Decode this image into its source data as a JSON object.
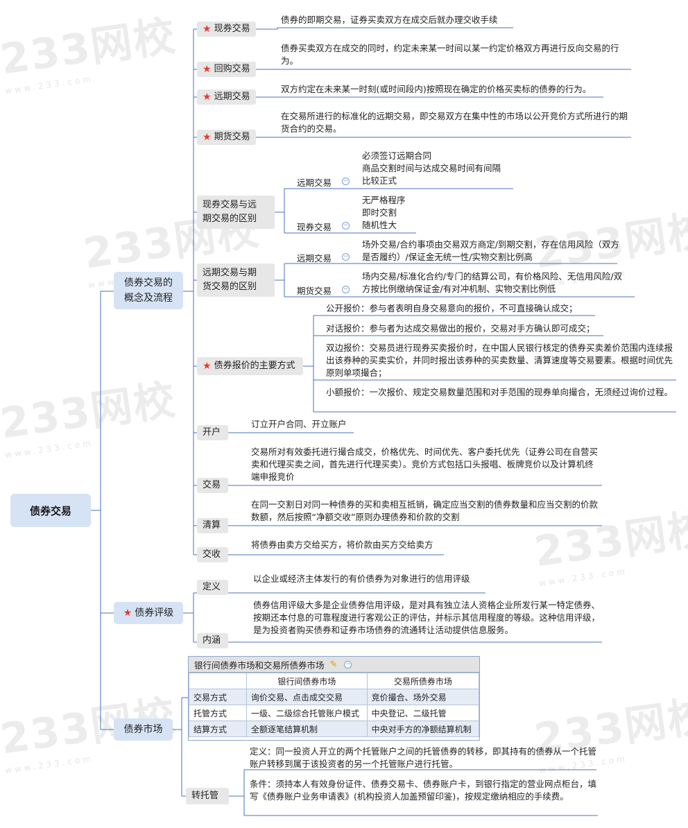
{
  "watermark": {
    "brand": "233网校",
    "url": "www.233.com"
  },
  "root": "债券交易",
  "branches": {
    "b1": "债券交易的概念及流程",
    "b2": "债券评级",
    "b3": "债券市场"
  },
  "b1": {
    "spot": {
      "label": "现券交易",
      "desc": "债券的即期交易，证券买卖双方在成交后就办理交收手续"
    },
    "repo": {
      "label": "回购交易",
      "desc": "债券买卖双方在成交的同时，约定未来某一时间以某一约定价格双方再进行反向交易的行为。"
    },
    "forward": {
      "label": "远期交易",
      "desc": "双方约定在未来某一时刻(或时间段内)按照现在确定的价格买卖标的债券的行为。"
    },
    "futures": {
      "label": "期货交易",
      "desc": "在交易所进行的标准化的远期交易，即交易双方在集中性的市场以公开竞价方式所进行的期货合约的交易。"
    },
    "diff1": {
      "label": "现券交易与远期交易的区别",
      "a_label": "远期交易",
      "a_items": [
        "必须签订远期合同",
        "商品交割时间与达成交易时间有间隔",
        "比较正式"
      ],
      "b_label": "现券交易",
      "b_items": [
        "无严格程序",
        "即时交割",
        "随机性大"
      ]
    },
    "diff2": {
      "label": "远期交易与期货交易的区别",
      "a_label": "远期交易",
      "a_desc": "场外交易/合约事项由交易双方商定/到期交割，存在信用风险（双方是否履约）/保证金无统一性/实物交割比例高",
      "b_label": "期货交易",
      "b_desc": "场内交易/标准化合约/专门的结算公司，有价格风险、无信用风险/双方按比例缴纳保证金/有对冲机制、实物交割比例低"
    },
    "quote": {
      "label": "债券报价的主要方式",
      "items": [
        "公开报价：参与者表明自身交易意向的报价，不可直接确认成交；",
        "对话报价：参与者为达成交易做出的报价，交易对手方确认即可成交；",
        "双边报价：交易员进行现券买卖报价时，在中国人民银行核定的债券买卖差价范围内连续报出该券种的买卖实价，并同时报出该券种的买卖数量、清算速度等交易要素。根据时间优先原则单项撮合；",
        "小额报价：一次报价、规定交易数量范围和对手范围的现券单向撮合，无须经过询价过程。"
      ]
    },
    "open": {
      "label": "开户",
      "desc": "订立开户合同、开立账户"
    },
    "trade": {
      "label": "交易",
      "desc": "交易所对有效委托进行撮合成交，价格优先、时间优先、客户委托优先（证券公司在自营买卖和代理买卖之间，首先进行代理买卖）。竞价方式包括口头报唱、板牌竞价以及计算机终端申报竞价"
    },
    "clear": {
      "label": "清算",
      "desc": "在同一交割日对同一种债券的买和卖相互抵销，确定应当交割的债券数量和应当交割的价款数额，然后按照“净额交收”原则办理债券和价款的交割"
    },
    "settle": {
      "label": "交收",
      "desc": "将债券由卖方交给买方，将价款由买方交给卖方"
    }
  },
  "b2": {
    "def": {
      "label": "定义",
      "desc": "以企业或经济主体发行的有价债券为对象进行的信用评级"
    },
    "content": {
      "label": "内涵",
      "desc": "债券信用评级大多是企业债券信用评级，是对具有独立法人资格企业所发行某一特定债券、按期还本付息的可靠程度进行客观公正的评估，并标示其信用程度的等级。这种信用评级，是为投资者购买债券和证券市场债券的流通转让活动提供信息服务。"
    }
  },
  "b3": {
    "table": {
      "title": "银行间债券市场和交易所债券市场",
      "headers": [
        "",
        "银行间债券市场",
        "交易所债券市场"
      ],
      "rows": [
        [
          "交易方式",
          "询价交易、点击成交交易",
          "竞价撮合、场外交易"
        ],
        [
          "托管方式",
          "一级、二级综合托管账户模式",
          "中央登记、二级托管"
        ],
        [
          "结算方式",
          "全额逐笔结算机制",
          "中央对手方的净额结算机制"
        ]
      ]
    },
    "transfer": {
      "label": "转托管",
      "def": "定义：同一投资人开立的两个托管账户之间的托管债券的转移，即其持有的债券从一个托管账户转移到属于该投资者的另一个托管账户进行托管。",
      "cond": "条件：须持本人有效身份证件、债券交易卡、债券账户卡，到银行指定的营业网点柜台，填写《债券账户业务申请表》(机构投资人加盖预留印鉴)，按规定缴纳相应的手续费。"
    }
  },
  "colors": {
    "line": "#4a72b8",
    "level1": "#d6e3f4",
    "level2": "#e7e7e7",
    "star": "#e53a2c"
  }
}
